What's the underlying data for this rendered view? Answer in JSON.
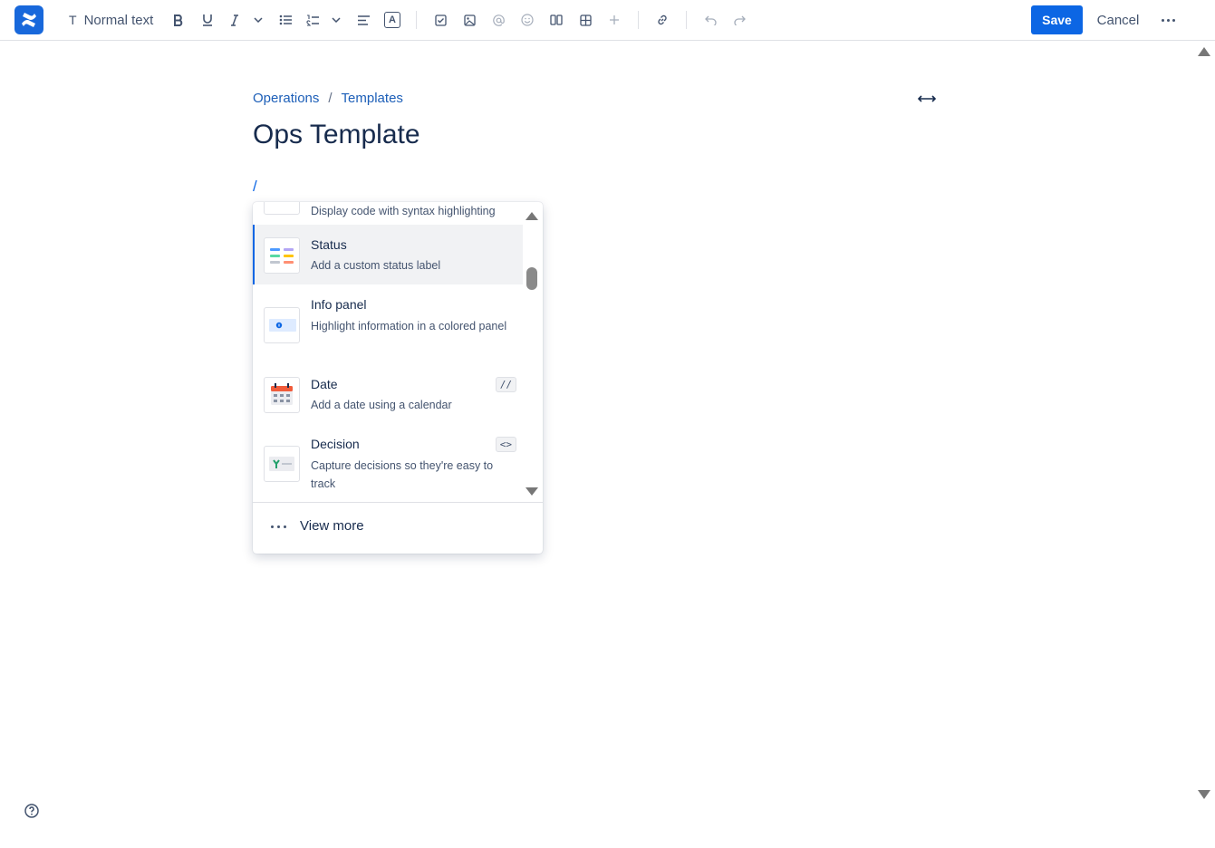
{
  "toolbar": {
    "text_style_icon": "T",
    "text_style_label": "Normal text",
    "text_color_icon_letter": "A",
    "save_label": "Save",
    "cancel_label": "Cancel",
    "icons": [
      "bold-icon",
      "underline-icon",
      "italic-icon",
      "chevron-down-icon",
      "bullet-list-icon",
      "numbered-list-icon",
      "chevron-down-icon",
      "align-icon",
      "text-color-icon",
      "task-icon",
      "image-icon",
      "mention-icon",
      "emoji-icon",
      "layout-icon",
      "table-icon",
      "insert-icon",
      "link-icon",
      "undo-icon",
      "redo-icon",
      "more-icon"
    ]
  },
  "breadcrumb": {
    "items": [
      "Operations",
      "Templates"
    ],
    "separator": "/"
  },
  "page": {
    "title": "Ops Template",
    "slash_command": "/"
  },
  "insert_menu": {
    "partial_item_desc": "Display code with syntax highlighting",
    "items": [
      {
        "name": "Status",
        "desc": "Add a custom status label",
        "shortcut": "",
        "icon": "status-icon",
        "selected": true
      },
      {
        "name": "Info panel",
        "desc": "Highlight information in a colored panel",
        "shortcut": "",
        "icon": "info-panel-icon",
        "selected": false
      },
      {
        "name": "Date",
        "desc": "Add a date using a calendar",
        "shortcut": "//",
        "icon": "calendar-icon",
        "selected": false
      },
      {
        "name": "Decision",
        "desc": "Capture decisions so they're easy to track",
        "shortcut": "<>",
        "icon": "decision-icon",
        "selected": false
      }
    ],
    "view_more_label": "View more"
  },
  "colors": {
    "accent": "#0c66e4",
    "logo": "#1868db",
    "selected_row": "#f1f2f4",
    "text": "#172b4d"
  }
}
